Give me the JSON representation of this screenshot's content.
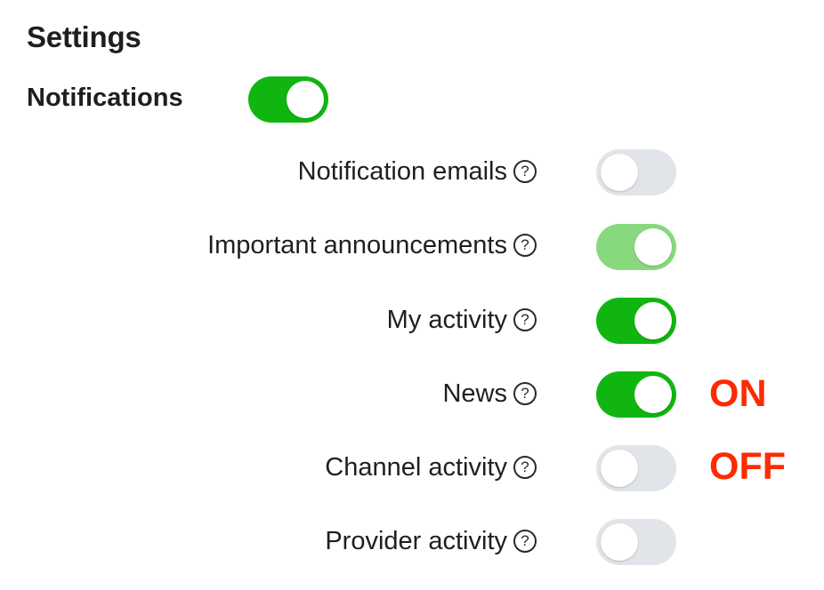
{
  "title": "Settings",
  "notifications": {
    "label": "Notifications",
    "enabled": true
  },
  "rows": [
    {
      "label": "Notification emails",
      "help_icon": "question-circle-icon",
      "help_glyph": "?",
      "state": "off"
    },
    {
      "label": "Important announcements",
      "help_icon": "question-circle-icon",
      "help_glyph": "?",
      "state": "on-light"
    },
    {
      "label": "My activity",
      "help_icon": "question-circle-icon",
      "help_glyph": "?",
      "state": "on"
    },
    {
      "label": "News",
      "help_icon": "question-circle-icon",
      "help_glyph": "?",
      "state": "on"
    },
    {
      "label": "Channel activity",
      "help_icon": "question-circle-icon",
      "help_glyph": "?",
      "state": "off"
    },
    {
      "label": "Provider activity",
      "help_icon": "question-circle-icon",
      "help_glyph": "?",
      "state": "off"
    }
  ],
  "annotations": {
    "on": "ON",
    "off": "OFF"
  },
  "colors": {
    "toggle_on": "#10b60f",
    "toggle_on_light": "#88d97e",
    "toggle_off": "#e1e4e8",
    "annotation": "#ff2a00"
  }
}
